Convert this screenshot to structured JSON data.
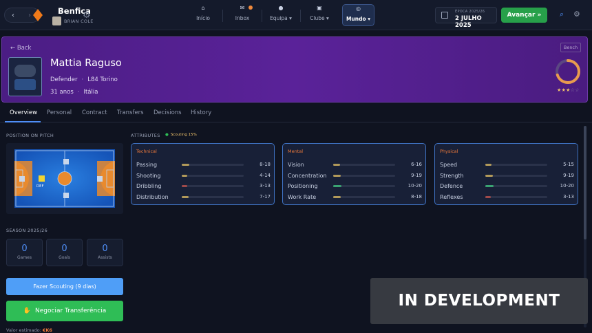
{
  "topbar": {
    "club_name": "Benfica",
    "manager_name": "BRIAN COLE",
    "nav_tabs": [
      {
        "label": "Início",
        "icon": "home-icon",
        "active": false
      },
      {
        "label": "Inbox",
        "icon": "mail-icon",
        "active": false
      },
      {
        "label": "Equipa",
        "icon": "ball-icon",
        "active": false
      },
      {
        "label": "Clube",
        "icon": "club-icon",
        "active": false
      },
      {
        "label": "Mundo",
        "icon": "globe-icon",
        "active": true
      }
    ],
    "season_label": "ÉPOCA 2025/26",
    "date": "2 JULHO 2025",
    "advance_label": "Avançar »"
  },
  "player": {
    "back_label": "← Back",
    "bench_label": "Bench",
    "name": "Mattia Raguso",
    "position": "Defender",
    "club": "L84 Torino",
    "age": "31 anos",
    "nationality": "Itália",
    "stars": "★★★",
    "stars_empty": "☆☆",
    "rating_fill_fraction": 0.7
  },
  "tabs": [
    "Overview",
    "Personal",
    "Contract",
    "Transfers",
    "Decisions",
    "History"
  ],
  "left": {
    "position_title": "POSITION ON PITCH",
    "position_tag": "DEF",
    "season_title": "SEASON 2025/26",
    "stats": [
      {
        "value": "0",
        "label": "Games"
      },
      {
        "value": "0",
        "label": "Goals"
      },
      {
        "value": "0",
        "label": "Assists"
      }
    ],
    "scout_button": "Fazer Scouting (9 dias)",
    "transfer_button": "Negociar Transferência",
    "value_label": "Valor estimado:",
    "value": "€K6"
  },
  "attributes": {
    "title": "ATTRIBUTES",
    "scouting": "Scouting 15%",
    "groups": [
      {
        "category": "Technical",
        "items": [
          {
            "name": "Passing",
            "range": "8-18",
            "color": "#b29a5a"
          },
          {
            "name": "Shooting",
            "range": "4-14",
            "color": "#b29a5a"
          },
          {
            "name": "Dribbling",
            "range": "3-13",
            "color": "#a04a4a"
          },
          {
            "name": "Distribution",
            "range": "7-17",
            "color": "#b29a5a"
          }
        ]
      },
      {
        "category": "Mental",
        "items": [
          {
            "name": "Vision",
            "range": "6-16",
            "color": "#b29a5a"
          },
          {
            "name": "Concentration",
            "range": "9-19",
            "color": "#b29a5a"
          },
          {
            "name": "Positioning",
            "range": "10-20",
            "color": "#3aa372"
          },
          {
            "name": "Work Rate",
            "range": "8-18",
            "color": "#b29a5a"
          }
        ]
      },
      {
        "category": "Physical",
        "items": [
          {
            "name": "Speed",
            "range": "5-15",
            "color": "#b29a5a"
          },
          {
            "name": "Strength",
            "range": "9-19",
            "color": "#b29a5a"
          },
          {
            "name": "Defence",
            "range": "10-20",
            "color": "#3aa372"
          },
          {
            "name": "Reflexes",
            "range": "3-13",
            "color": "#a04a4a"
          }
        ]
      }
    ]
  },
  "overlay": "IN DEVELOPMENT"
}
